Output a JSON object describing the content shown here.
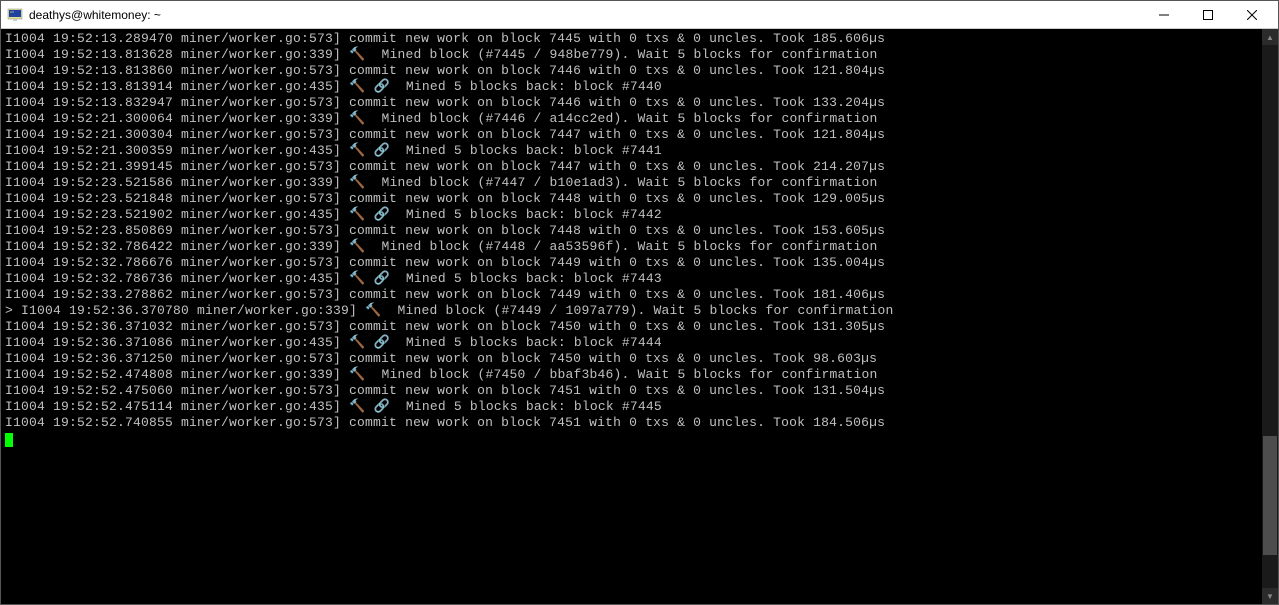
{
  "window": {
    "title": "deathys@whitemoney: ~"
  },
  "scrollbar": {
    "thumb_top_pct": 72,
    "thumb_height_pct": 22
  },
  "terminal": {
    "lines": [
      "I1004 19:52:13.289470 miner/worker.go:573] commit new work on block 7445 with 0 txs & 0 uncles. Took 185.606µs",
      "I1004 19:52:13.813628 miner/worker.go:339] 🔨  Mined block (#7445 / 948be779). Wait 5 blocks for confirmation",
      "I1004 19:52:13.813860 miner/worker.go:573] commit new work on block 7446 with 0 txs & 0 uncles. Took 121.804µs",
      "I1004 19:52:13.813914 miner/worker.go:435] 🔨 🔗  Mined 5 blocks back: block #7440",
      "I1004 19:52:13.832947 miner/worker.go:573] commit new work on block 7446 with 0 txs & 0 uncles. Took 133.204µs",
      "I1004 19:52:21.300064 miner/worker.go:339] 🔨  Mined block (#7446 / a14cc2ed). Wait 5 blocks for confirmation",
      "I1004 19:52:21.300304 miner/worker.go:573] commit new work on block 7447 with 0 txs & 0 uncles. Took 121.804µs",
      "I1004 19:52:21.300359 miner/worker.go:435] 🔨 🔗  Mined 5 blocks back: block #7441",
      "I1004 19:52:21.399145 miner/worker.go:573] commit new work on block 7447 with 0 txs & 0 uncles. Took 214.207µs",
      "I1004 19:52:23.521586 miner/worker.go:339] 🔨  Mined block (#7447 / b10e1ad3). Wait 5 blocks for confirmation",
      "I1004 19:52:23.521848 miner/worker.go:573] commit new work on block 7448 with 0 txs & 0 uncles. Took 129.005µs",
      "I1004 19:52:23.521902 miner/worker.go:435] 🔨 🔗  Mined 5 blocks back: block #7442",
      "I1004 19:52:23.850869 miner/worker.go:573] commit new work on block 7448 with 0 txs & 0 uncles. Took 153.605µs",
      "I1004 19:52:32.786422 miner/worker.go:339] 🔨  Mined block (#7448 / aa53596f). Wait 5 blocks for confirmation",
      "I1004 19:52:32.786676 miner/worker.go:573] commit new work on block 7449 with 0 txs & 0 uncles. Took 135.004µs",
      "I1004 19:52:32.786736 miner/worker.go:435] 🔨 🔗  Mined 5 blocks back: block #7443",
      "I1004 19:52:33.278862 miner/worker.go:573] commit new work on block 7449 with 0 txs & 0 uncles. Took 181.406µs",
      "> I1004 19:52:36.370780 miner/worker.go:339] 🔨  Mined block (#7449 / 1097a779). Wait 5 blocks for confirmation",
      "I1004 19:52:36.371032 miner/worker.go:573] commit new work on block 7450 with 0 txs & 0 uncles. Took 131.305µs",
      "I1004 19:52:36.371086 miner/worker.go:435] 🔨 🔗  Mined 5 blocks back: block #7444",
      "I1004 19:52:36.371250 miner/worker.go:573] commit new work on block 7450 with 0 txs & 0 uncles. Took 98.603µs",
      "I1004 19:52:52.474808 miner/worker.go:339] 🔨  Mined block (#7450 / bbaf3b46). Wait 5 blocks for confirmation",
      "I1004 19:52:52.475060 miner/worker.go:573] commit new work on block 7451 with 0 txs & 0 uncles. Took 131.504µs",
      "I1004 19:52:52.475114 miner/worker.go:435] 🔨 🔗  Mined 5 blocks back: block #7445",
      "I1004 19:52:52.740855 miner/worker.go:573] commit new work on block 7451 with 0 txs & 0 uncles. Took 184.506µs"
    ]
  }
}
